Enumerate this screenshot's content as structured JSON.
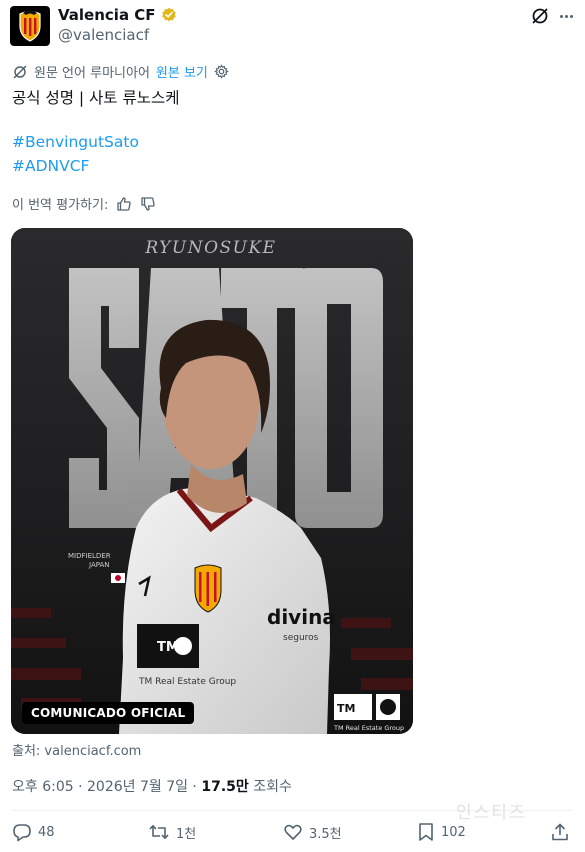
{
  "header": {
    "display_name": "Valencia CF",
    "handle": "@valenciacf"
  },
  "translate": {
    "text": "원문 언어 루마니아어",
    "link": "원본 보기"
  },
  "tweet": {
    "text": "공식 성명 | 사토 류노스케",
    "hashtags": [
      "#BenvingutSato",
      "#ADNVCF"
    ],
    "rate_label": "이 번역 평가하기:"
  },
  "media": {
    "top_name": "RYUNOSUKE",
    "big_name": "SATO",
    "position_label": "MIDFIELDER",
    "country_label": "JAPAN",
    "sponsor_shirt": "TM Real Estate Group",
    "sponsor_sleeve": "divina",
    "sponsor_sleeve_sub": "seguros",
    "corner_logo_sub": "TM Real Estate Group",
    "badge": "COMUNICADO OFICIAL"
  },
  "source": "출처: valenciacf.com",
  "meta": {
    "time": "오후 6:05 · 2026년 7월 7일 · ",
    "views_count": "17.5만",
    "views_label": " 조회수"
  },
  "actions": {
    "replies": "48",
    "retweets": "1천",
    "likes": "3.5천",
    "bookmarks": "102"
  },
  "watermark": "인스티즈",
  "colors": {
    "link": "#1d9bf0",
    "verified": "#e2b719",
    "secondary_text": "#536471"
  }
}
